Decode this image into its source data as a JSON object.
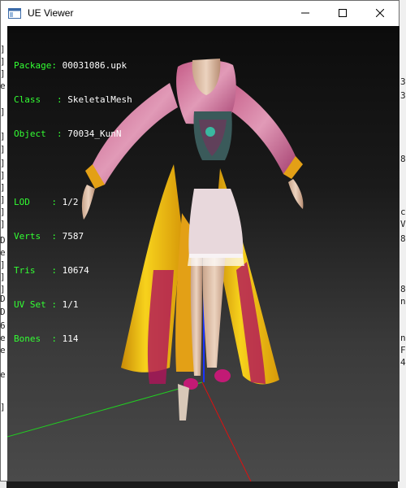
{
  "window": {
    "title": "UE Viewer",
    "controls": [
      "minimize",
      "maximize",
      "close"
    ]
  },
  "mesh_info": {
    "package_label": "Package",
    "package_value": "00031086.upk",
    "class_label": "Class",
    "class_value": "SkeletalMesh",
    "object_label": "Object",
    "object_value": "70034_KunN",
    "lod_label": "LOD",
    "lod_value": "1/2",
    "verts_label": "Verts",
    "verts_value": "7587",
    "tris_label": "Tris",
    "tris_value": "10674",
    "uvset_label": "UV Set",
    "uvset_value": "1/1",
    "bones_label": "Bones",
    "bones_value": "114"
  },
  "colors": {
    "label": "#33ff33",
    "value": "#ffffff",
    "axis_x": "#dd1111",
    "axis_y": "#22cc22",
    "axis_z": "#1a33ff",
    "dress_yellow": "#f2c10a",
    "dress_pink": "#d9779a",
    "dress_magenta": "#b0145a"
  },
  "background_text": {
    "left": [
      "]",
      "]",
      "]",
      "e",
      "]",
      "]",
      "]",
      "]",
      "]",
      "]",
      "]",
      "]",
      "]",
      "D",
      "e",
      "]",
      "]",
      "]",
      "D",
      "D",
      "6",
      "e",
      "e",
      "",
      "e",
      "",
      "]"
    ],
    "right": [
      "3",
      "3",
      "8",
      "c",
      "V",
      "8",
      "8",
      "n",
      "n",
      "F",
      "4"
    ]
  }
}
